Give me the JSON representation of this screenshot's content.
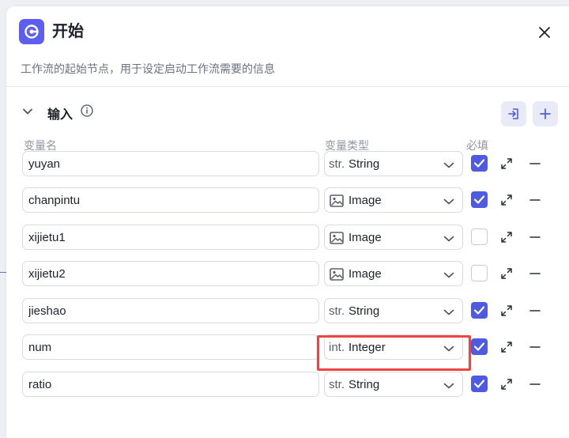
{
  "header": {
    "title": "开始",
    "subtitle": "工作流的起始节点，用于设定启动工作流需要的信息"
  },
  "section": {
    "title": "输入"
  },
  "columns": {
    "name": "变量名",
    "type": "变量类型",
    "required": "必填"
  },
  "rows": [
    {
      "name": "yuyan",
      "type_prefix": "str.",
      "type": "String",
      "required": true
    },
    {
      "name": "chanpintu",
      "type_prefix": "image-icon",
      "type": "Image",
      "required": true
    },
    {
      "name": "xijietu1",
      "type_prefix": "image-icon",
      "type": "Image",
      "required": false
    },
    {
      "name": "xijietu2",
      "type_prefix": "image-icon",
      "type": "Image",
      "required": false
    },
    {
      "name": "jieshao",
      "type_prefix": "str.",
      "type": "String",
      "required": true
    },
    {
      "name": "num",
      "type_prefix": "int.",
      "type": "Integer",
      "required": true,
      "highlighted": true
    },
    {
      "name": "ratio",
      "type_prefix": "str.",
      "type": "String",
      "required": true
    }
  ],
  "colors": {
    "accent": "#4e5be0",
    "highlight": "#ef4444"
  }
}
